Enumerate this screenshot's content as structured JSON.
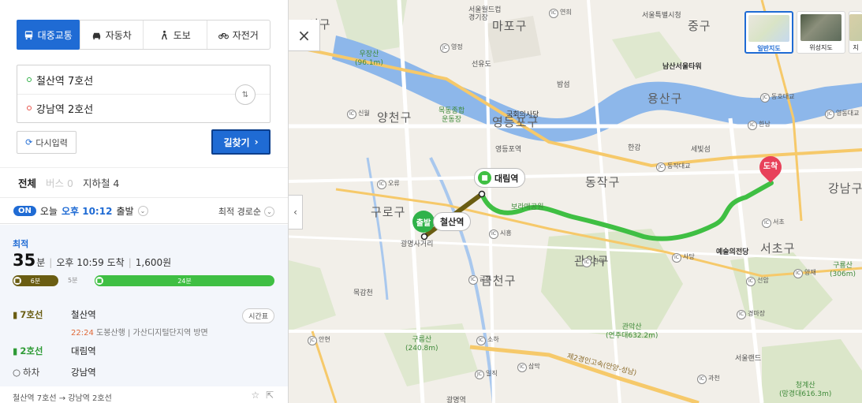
{
  "modes": [
    {
      "label": "대중교통",
      "icon": "bus-icon",
      "active": true
    },
    {
      "label": "자동차",
      "icon": "car-icon",
      "active": false
    },
    {
      "label": "도보",
      "icon": "walk-icon",
      "active": false
    },
    {
      "label": "자전거",
      "icon": "bike-icon",
      "active": false
    }
  ],
  "route": {
    "origin": "철산역 7호선",
    "destination": "강남역 2호선",
    "reset_label": "다시입력",
    "search_label": "길찾기"
  },
  "tabs": {
    "all": "전체",
    "bus": "버스 0",
    "subway": "지하철 4"
  },
  "departure": {
    "badge": "ON",
    "day": "오늘",
    "time": "오후 10:12",
    "suffix": "출발",
    "sort": "최적 경로순"
  },
  "result": {
    "tag": "최적",
    "duration_num": "35",
    "duration_unit": "분",
    "arrival": "오후 10:59 도착",
    "fare": "1,600원",
    "seg1": "6분",
    "walk": "5분",
    "seg2": "24분",
    "steps": [
      {
        "line": "7호선",
        "station": "철산역"
      },
      {
        "line": "2호선",
        "station": "대림역"
      },
      {
        "line": "하차",
        "station": "강남역"
      }
    ],
    "detail_time": "22:24",
    "detail_text": "도봉산행 | 가산디지털단지역 방면",
    "timetable": "시간표",
    "next_route": "철산역 7호선 → 강남역 2호선"
  },
  "map": {
    "close": "×",
    "collapse": "‹",
    "map_types": [
      "일반지도",
      "위성지도",
      "지"
    ],
    "districts": [
      "서구",
      "마포구",
      "중구",
      "용산구",
      "양천구",
      "영등포구",
      "동작구",
      "강남구",
      "구로구",
      "관악구",
      "서초구",
      "금천구"
    ],
    "pois": {
      "wcup": "서울월드컵\n경기장",
      "yeonhui": "연희",
      "seodaemun": "서울특별시청",
      "seonyudo": "선유도",
      "bamseom": "밤섬",
      "namsan": "남산서울타워",
      "assembly": "국회의사당",
      "yeongdeungpo_station": "영등포역",
      "hangang": "한강",
      "sebitseom": "세빛섬",
      "art_center": "예술의전당",
      "gwangmyeong": "광명사거리",
      "mokgamcheon": "목감천",
      "seoulland": "서울랜드",
      "road": "제2경인고속(안양-성남)",
      "gwangmyeong2": "광명역"
    },
    "parks": {
      "woojang": "우장산\n(96.1m)",
      "mokdong": "목동종합\n운동장",
      "gwanak": "관악산\n(연주대632.2m)",
      "gureung": "구룡산\n(306m)",
      "guruksan": "구름산\n(240.8m)",
      "cheonggye": "청계산\n(망경대616.3m)",
      "boramae": "보라매공원"
    },
    "ic_tags": [
      "연희",
      "영정",
      "신월",
      "오류",
      "시흥",
      "동작대교",
      "한남",
      "동호대교",
      "영동대교",
      "서초",
      "사당",
      "관악",
      "금천",
      "선암",
      "양재",
      "경마장",
      "안현",
      "소하",
      "삼막",
      "일직",
      "과천"
    ],
    "route_labels": {
      "start": "출발",
      "start_station": "철산역",
      "transfer": "대림역",
      "end": "도착"
    },
    "road_numbers": [
      "6",
      "6",
      "46",
      "46",
      "397",
      "397",
      "42",
      "309",
      "1"
    ]
  },
  "colors": {
    "primary": "#1f6bd4",
    "line7": "#6a5d12",
    "line2": "#3fbf43",
    "river": "#8db7ea",
    "end_pin": "#e8415a"
  }
}
